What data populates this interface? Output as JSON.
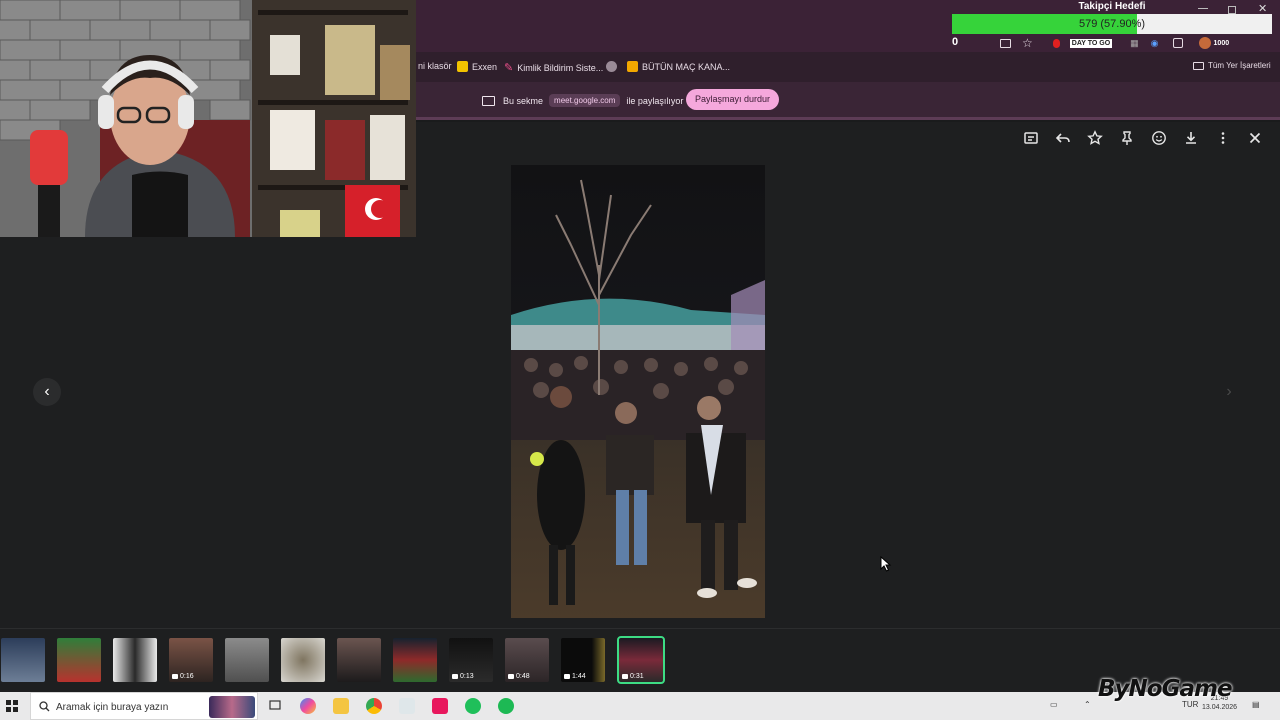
{
  "follower_goal": {
    "title": "Takipçi Hedefi",
    "text": "579 (57.90%)",
    "progress": 0.579,
    "extra_count": "0"
  },
  "browser": {
    "toolbar_text": "DAY TO GO",
    "toolbar_count": "1000",
    "bookmarks": [
      {
        "label": "ni klasör",
        "icon": "folder-icon"
      },
      {
        "label": "Exxen",
        "icon": "exxen-icon",
        "color": "#f3c300"
      },
      {
        "label": "Kimlik Bildirim Siste...",
        "icon": "kimlik-icon",
        "color": "#e94f8a"
      },
      {
        "label": "",
        "icon": "globe-icon"
      },
      {
        "label": "BÜTÜN MAÇ KANA...",
        "icon": "jp-icon",
        "color": "#f3a800"
      }
    ],
    "all_bookmarks": "Tüm Yer İşaretleri"
  },
  "share_bar": {
    "prefix": "Bu sekme",
    "domain": "meet.google.com",
    "suffix": "ile paylaşılıyor",
    "stop_button": "Paylaşmayı durdur"
  },
  "viewer": {
    "tools": [
      "caption-icon",
      "reply-icon",
      "star-icon",
      "pin-icon",
      "emoji-icon",
      "download-icon",
      "more-icon",
      "close-icon"
    ],
    "thumbnails": [
      {
        "duration": ""
      },
      {
        "duration": ""
      },
      {
        "duration": ""
      },
      {
        "duration": "0:16"
      },
      {
        "duration": ""
      },
      {
        "duration": ""
      },
      {
        "duration": ""
      },
      {
        "duration": ""
      },
      {
        "duration": "0:13"
      },
      {
        "duration": "0:48"
      },
      {
        "duration": "1:44"
      },
      {
        "duration": "0:31",
        "selected": true
      }
    ]
  },
  "taskbar": {
    "search_placeholder": "Aramak için buraya yazın",
    "language": "TUR",
    "time": "21:49",
    "date": "13.04.2026"
  },
  "watermark": "ByNoGame"
}
